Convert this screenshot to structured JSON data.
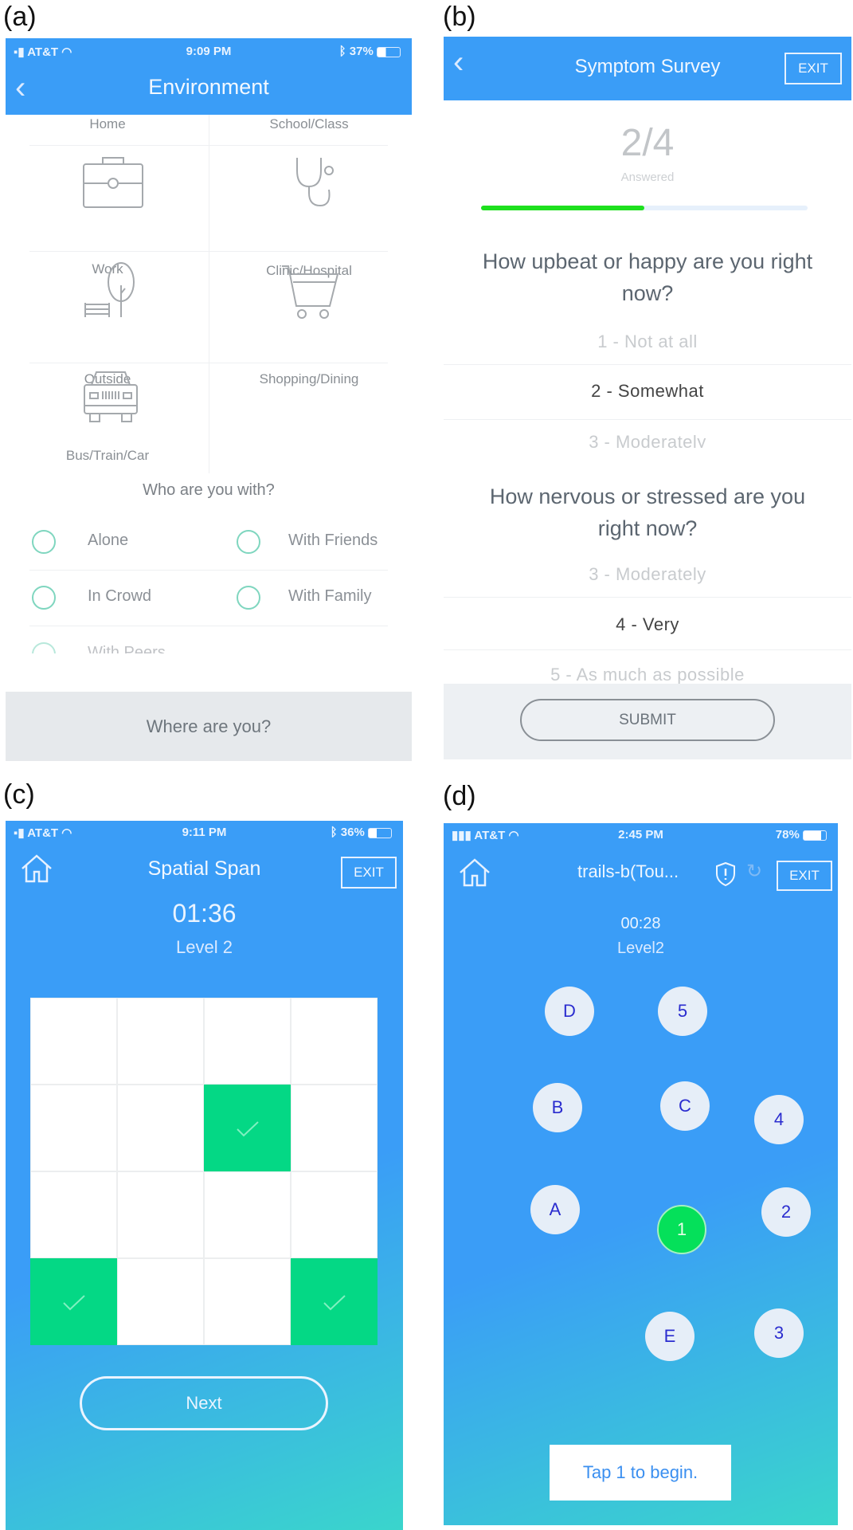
{
  "panel_labels": [
    "(a)",
    "(b)",
    "(c)",
    "(d)"
  ],
  "a": {
    "status": {
      "carrier": "AT&T",
      "time": "9:09 PM",
      "battery": "37%"
    },
    "title": "Environment",
    "locations": [
      "Home",
      "School/Class",
      "Work",
      "Clinic/Hospital",
      "Outside",
      "Shopping/Dining",
      "Bus/Train/Car"
    ],
    "icons": [
      "briefcase-icon",
      "stethoscope-icon",
      "tree-bench-icon",
      "shopping-cart-icon",
      "car-icon"
    ],
    "who_title": "Who are you with?",
    "who_options": [
      "Alone",
      "With Friends",
      "In Crowd",
      "With Family",
      "With Peers"
    ],
    "footer": "Where are you?",
    "accent": "#3a9df7",
    "radio_color": "#7fd6bf"
  },
  "b": {
    "title": "Symptom Survey",
    "exit": "EXIT",
    "progress_text": "2/4",
    "progress_label": "Answered",
    "progress_fraction": 0.5,
    "progress_color": "#1ee01e",
    "q1": {
      "text": "How upbeat or happy are you right now?",
      "options": [
        "1 - Not at all",
        "2 - Somewhat",
        "3 - Moderately"
      ],
      "selected": "2 - Somewhat"
    },
    "q2": {
      "text": "How nervous or stressed are you right now?",
      "options": [
        "3 - Moderately",
        "4 - Very",
        "5 - As much as possible"
      ],
      "selected": "4 - Very"
    },
    "submit": "SUBMIT"
  },
  "c": {
    "status": {
      "carrier": "AT&T",
      "time": "9:11 PM",
      "battery": "36%"
    },
    "title": "Spatial Span",
    "exit": "EXIT",
    "timer": "01:36",
    "level": "Level 2",
    "grid": {
      "rows": 4,
      "cols": 4,
      "selected": [
        [
          1,
          2
        ],
        [
          3,
          0
        ],
        [
          3,
          3
        ]
      ]
    },
    "selected_color": "#04d885",
    "next": "Next"
  },
  "d": {
    "status": {
      "carrier": "AT&T",
      "time": "2:45 PM",
      "battery": "78%"
    },
    "title": "trails-b(Tou...",
    "exit": "EXIT",
    "timer": "00:28",
    "level": "Level2",
    "nodes": [
      {
        "label": "D",
        "active": false
      },
      {
        "label": "5",
        "active": false
      },
      {
        "label": "B",
        "active": false
      },
      {
        "label": "C",
        "active": false
      },
      {
        "label": "4",
        "active": false
      },
      {
        "label": "A",
        "active": false
      },
      {
        "label": "1",
        "active": true
      },
      {
        "label": "2",
        "active": false
      },
      {
        "label": "E",
        "active": false
      },
      {
        "label": "3",
        "active": false
      }
    ],
    "active_color": "#05e05a",
    "hint": "Tap 1 to begin."
  }
}
